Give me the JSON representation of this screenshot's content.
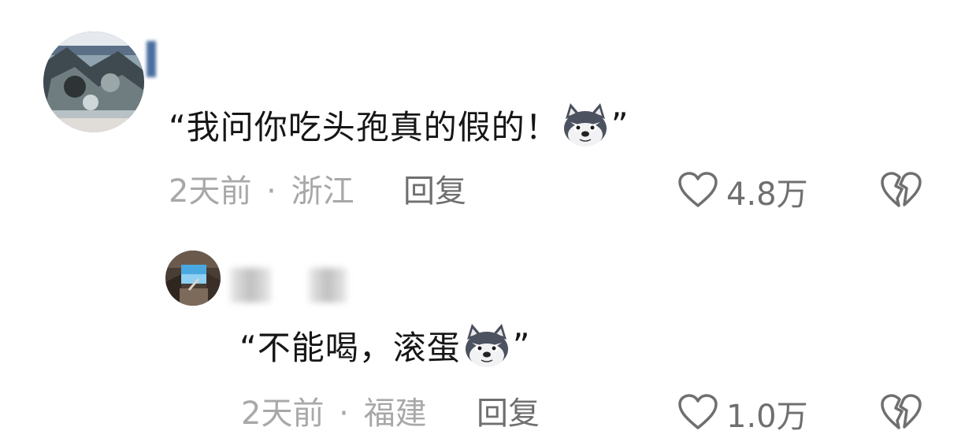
{
  "comments": [
    {
      "text_open": "“我问你吃头孢真的假的！",
      "text_close": "”",
      "emoji": "husky-dog-emoji",
      "time": "2天前",
      "separator": "·",
      "location": "浙江",
      "reply_label": "回复",
      "likes": "4.8万"
    },
    {
      "text_open": "“不能喝，滚蛋",
      "text_close": "”",
      "emoji": "husky-dog-emoji",
      "time": "2天前",
      "separator": "·",
      "location": "福建",
      "reply_label": "回复",
      "likes": "1.0万"
    }
  ],
  "icons": {
    "like": "heart-icon",
    "dislike": "broken-heart-icon"
  },
  "colors": {
    "text": "#161616",
    "meta": "#a8a8a8",
    "action": "#6f6f6f"
  }
}
